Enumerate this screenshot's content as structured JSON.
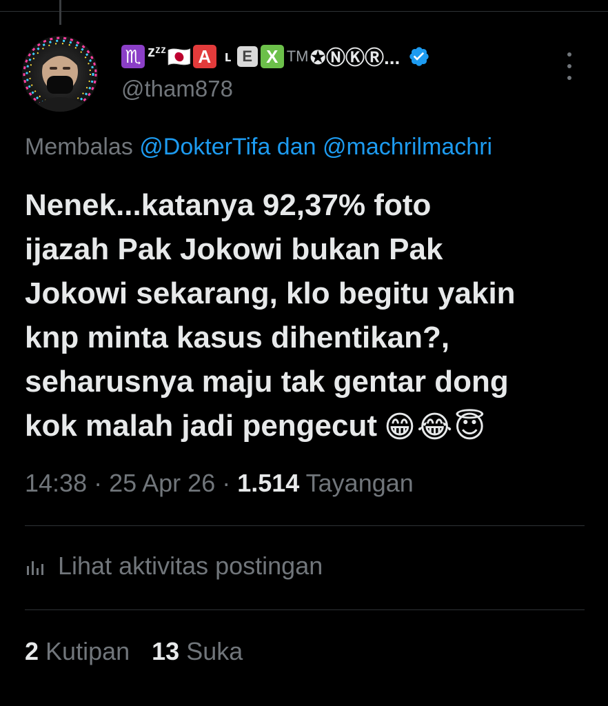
{
  "author": {
    "name_parts": [
      "♏",
      "zᶻᶻ",
      "🇯🇵",
      "A",
      "ʟ",
      "E",
      "X",
      "TM",
      "✪ⓃⓀⓇ..."
    ],
    "handle": "@tham878",
    "verified": true
  },
  "reply": {
    "prefix": "Membalas ",
    "mention1": "@DokterTifa",
    "joiner": " dan ",
    "mention2": "@machrilmachri"
  },
  "tweet": {
    "lines": [
      "Nenek...katanya 92,37% foto",
      "ijazah Pak Jokowi bukan Pak",
      "Jokowi sekarang, klo begitu yakin",
      "knp minta kasus dihentikan?,",
      "seharusnya maju tak gentar dong",
      "kok malah jadi pengecut"
    ],
    "emojis": [
      "😁",
      "😂",
      "😇"
    ]
  },
  "meta": {
    "time": "14:38",
    "sep": " · ",
    "date": "25 Apr 26",
    "views_count": "1.514",
    "views_label": " Tayangan"
  },
  "activity": {
    "label": "Lihat aktivitas postingan",
    "icon": "analytics-icon"
  },
  "stats": {
    "quotes_count": "2",
    "quotes_label": " Kutipan",
    "likes_count": "13",
    "likes_label": " Suka"
  },
  "colors": {
    "background": "#000000",
    "text": "#e7e9ea",
    "muted": "#71767b",
    "link": "#1d9bf0",
    "divider": "#2f3336",
    "verified": "#1d9bf0"
  }
}
